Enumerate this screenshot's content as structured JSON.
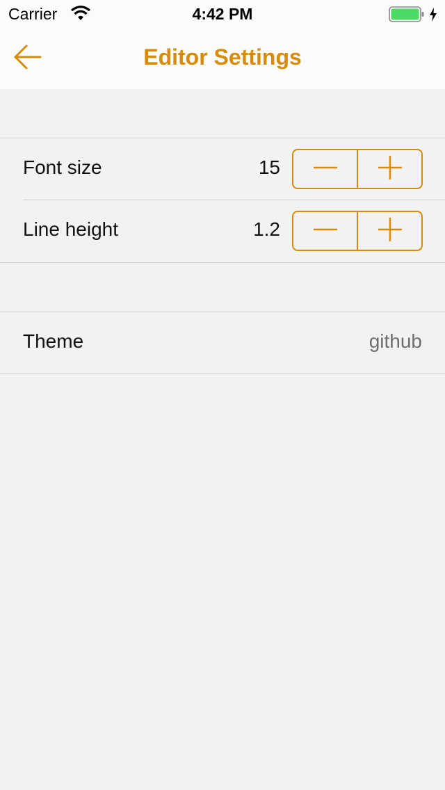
{
  "status_bar": {
    "carrier": "Carrier",
    "time": "4:42 PM",
    "battery_color": "#4cd964"
  },
  "nav": {
    "title": "Editor Settings",
    "back_icon": "arrow-left-icon",
    "accent_color": "#d68c0a"
  },
  "settings": {
    "font_size": {
      "label": "Font size",
      "value": "15"
    },
    "line_height": {
      "label": "Line height",
      "value": "1.2"
    },
    "theme": {
      "label": "Theme",
      "value": "github"
    }
  }
}
